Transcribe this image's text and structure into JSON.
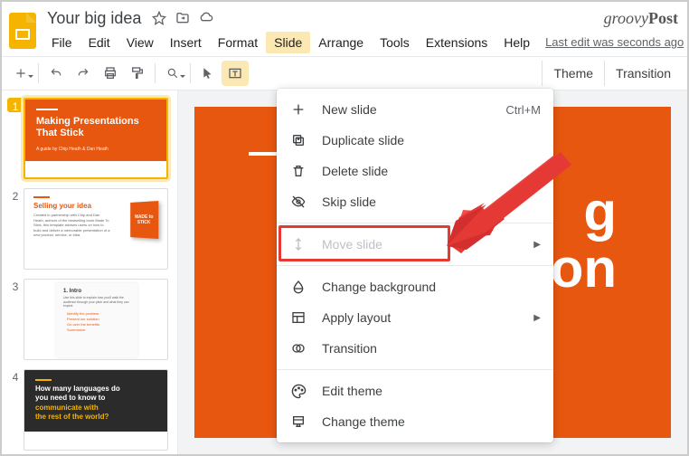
{
  "watermark": {
    "pre": "groovy",
    "post": "Post"
  },
  "document": {
    "title": "Your big idea"
  },
  "menus": [
    "File",
    "Edit",
    "View",
    "Insert",
    "Format",
    "Slide",
    "Arrange",
    "Tools",
    "Extensions",
    "Help"
  ],
  "menu_active_index": 5,
  "last_edit": "Last edit was seconds ago",
  "toolbar_right": {
    "theme": "Theme",
    "transition": "Transition"
  },
  "slide_menu": {
    "new_slide": "New slide",
    "new_slide_shortcut": "Ctrl+M",
    "duplicate": "Duplicate slide",
    "delete": "Delete slide",
    "skip": "Skip slide",
    "move": "Move slide",
    "change_bg": "Change background",
    "apply_layout": "Apply layout",
    "transition": "Transition",
    "edit_theme": "Edit theme",
    "change_theme": "Change theme"
  },
  "thumbnails": {
    "s1": {
      "title": "Making Presentations That Stick",
      "sub": "A guide by Chip Heath & Dan Heath"
    },
    "s2": {
      "title": "Selling your idea",
      "text": "Created in partnership with Chip and Dan Heath, authors of the bestselling book Made To Stick, this template advises users on how to build and deliver a memorable presentation of a new product, service, or idea.",
      "book": "MADE to STICK"
    },
    "s3": {
      "title": "1. Intro",
      "text": "Use this slide to explain how you'll walk the audience through your pitch and what they can expect.",
      "b1": "Identify the problem",
      "b2": "Present our solution",
      "b3": "Go over the benefits",
      "b4": "Summarize"
    },
    "s4": {
      "ln1": "How many languages do",
      "ln2": "you need to know to",
      "ln3a": "communicate with",
      "ln4a": "the rest of the world?"
    }
  },
  "canvas": {
    "title_l1": "g",
    "title_l2": "ntation"
  }
}
